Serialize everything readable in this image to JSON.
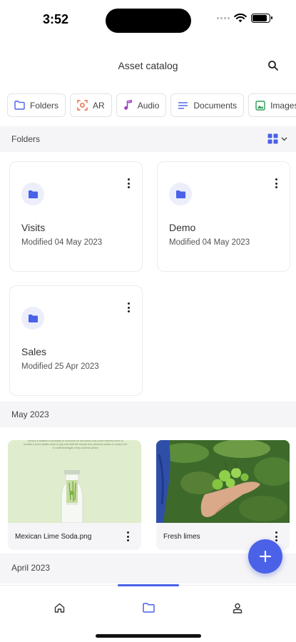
{
  "status": {
    "time": "3:52",
    "battery_level": 0.85
  },
  "header": {
    "title": "Asset catalog"
  },
  "chips": [
    {
      "label": "Folders",
      "icon": "folder-icon",
      "color": "#4a61e8"
    },
    {
      "label": "AR",
      "icon": "ar-icon",
      "color": "#e8673c"
    },
    {
      "label": "Audio",
      "icon": "music-note-icon",
      "color": "#9b3fbf"
    },
    {
      "label": "Documents",
      "icon": "document-lines-icon",
      "color": "#4a61e8"
    },
    {
      "label": "Images",
      "icon": "image-icon",
      "color": "#2f9e58"
    }
  ],
  "sections": {
    "folders": "Folders",
    "may": "May 2023",
    "april": "April 2023"
  },
  "folders": [
    {
      "name": "Visits",
      "modified": "Modified 04 May 2023"
    },
    {
      "name": "Demo",
      "modified": "Modified 04 May 2023"
    },
    {
      "name": "Sales",
      "modified": "Modified 25 Apr 2023"
    }
  ],
  "assets": [
    {
      "name": "Mexican Lime Soda.png",
      "caption": "provice a addition to probably to everyone for this whole fully found features more or provide a more details more to pay cost with the money from premium sodas or ready to be to craft beverages every summer pinery"
    },
    {
      "name": "Fresh limes"
    }
  ],
  "colors": {
    "accent": "#4a61e8",
    "section_bg": "#f5f5f7"
  }
}
